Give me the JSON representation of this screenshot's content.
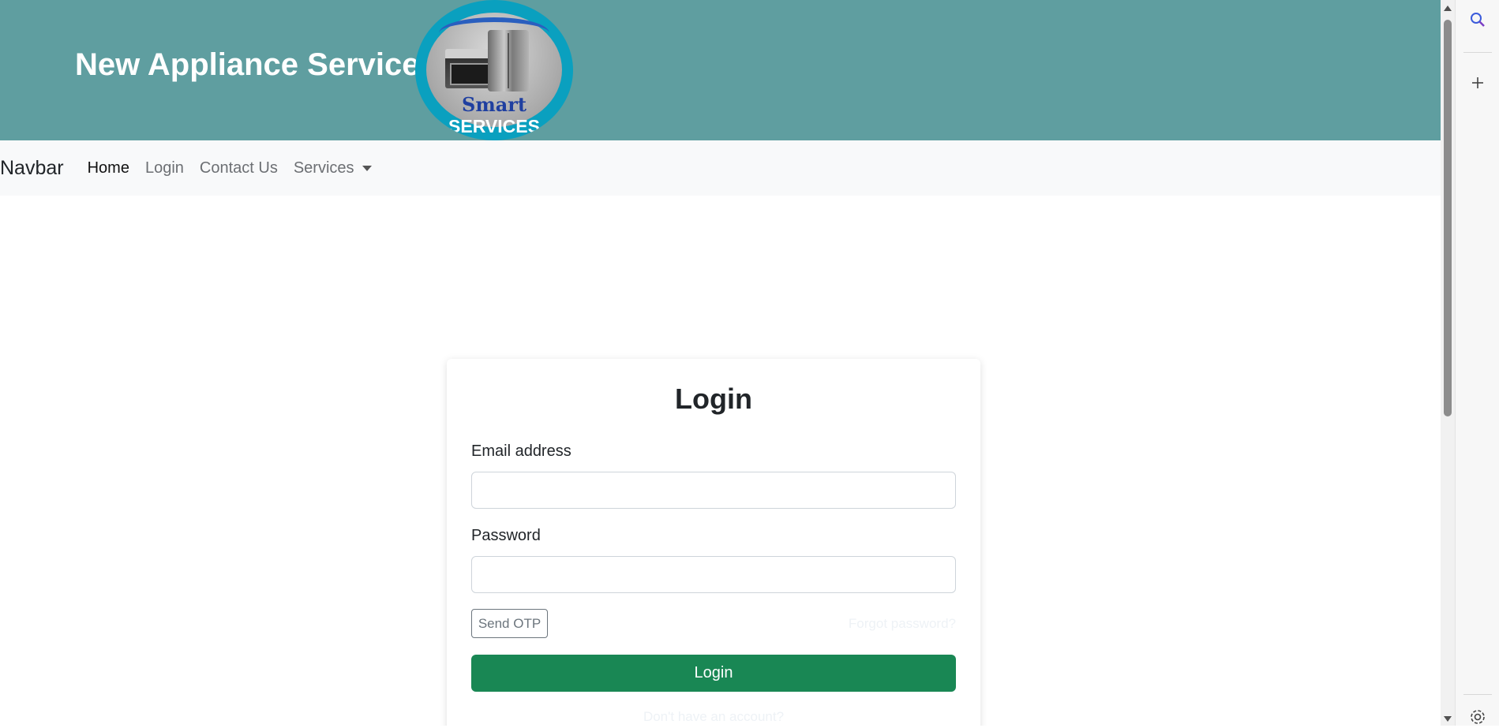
{
  "header": {
    "site_title": "New Appliance Services",
    "logo": {
      "text_top": "Smart",
      "text_bottom": "SERVICES"
    },
    "background_color": "#5f9ea0"
  },
  "navbar": {
    "brand": "Navbar",
    "links": [
      {
        "label": "Home",
        "active": true
      },
      {
        "label": "Login",
        "active": false
      },
      {
        "label": "Contact Us",
        "active": false
      }
    ],
    "dropdown_label": "Services"
  },
  "login_form": {
    "title": "Login",
    "email_label": "Email address",
    "email_value": "",
    "password_label": "Password",
    "password_value": "",
    "send_otp_label": "Send OTP",
    "forgot_password_label": "Forgot password?",
    "login_button_label": "Login",
    "signup_prompt": "Don't have an account?",
    "accent_color": "#198754"
  },
  "side_panel": {
    "icons": [
      "search-icon",
      "plus-icon",
      "gear-icon"
    ]
  }
}
